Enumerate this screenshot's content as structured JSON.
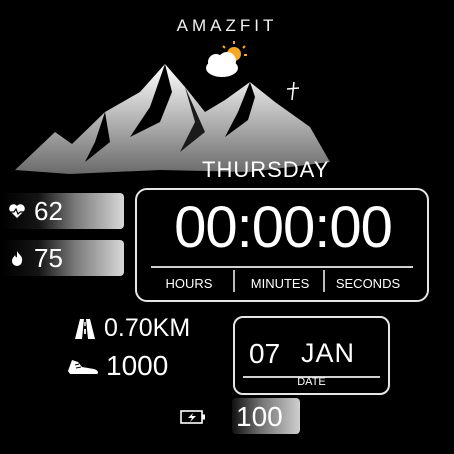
{
  "brand": "AMAZFIT",
  "weather": {
    "icon": "partly-cloudy-icon"
  },
  "weekday": "THURSDAY",
  "heart_rate": {
    "icon": "heart-icon",
    "value": "62"
  },
  "calories": {
    "icon": "flame-icon",
    "value": "75"
  },
  "time": {
    "display": "00:00:00",
    "labels": {
      "hours": "HOURS",
      "minutes": "MINUTES",
      "seconds": "SECONDS"
    }
  },
  "distance": {
    "icon": "road-icon",
    "value": "0.70KM"
  },
  "steps": {
    "icon": "shoe-icon",
    "value": "1000"
  },
  "date": {
    "day": "07",
    "month": "JAN",
    "label": "DATE"
  },
  "battery": {
    "icon": "battery-icon",
    "value": "100"
  },
  "colors": {
    "background": "#000000",
    "foreground": "#ffffff",
    "sun": "#f5a623"
  }
}
